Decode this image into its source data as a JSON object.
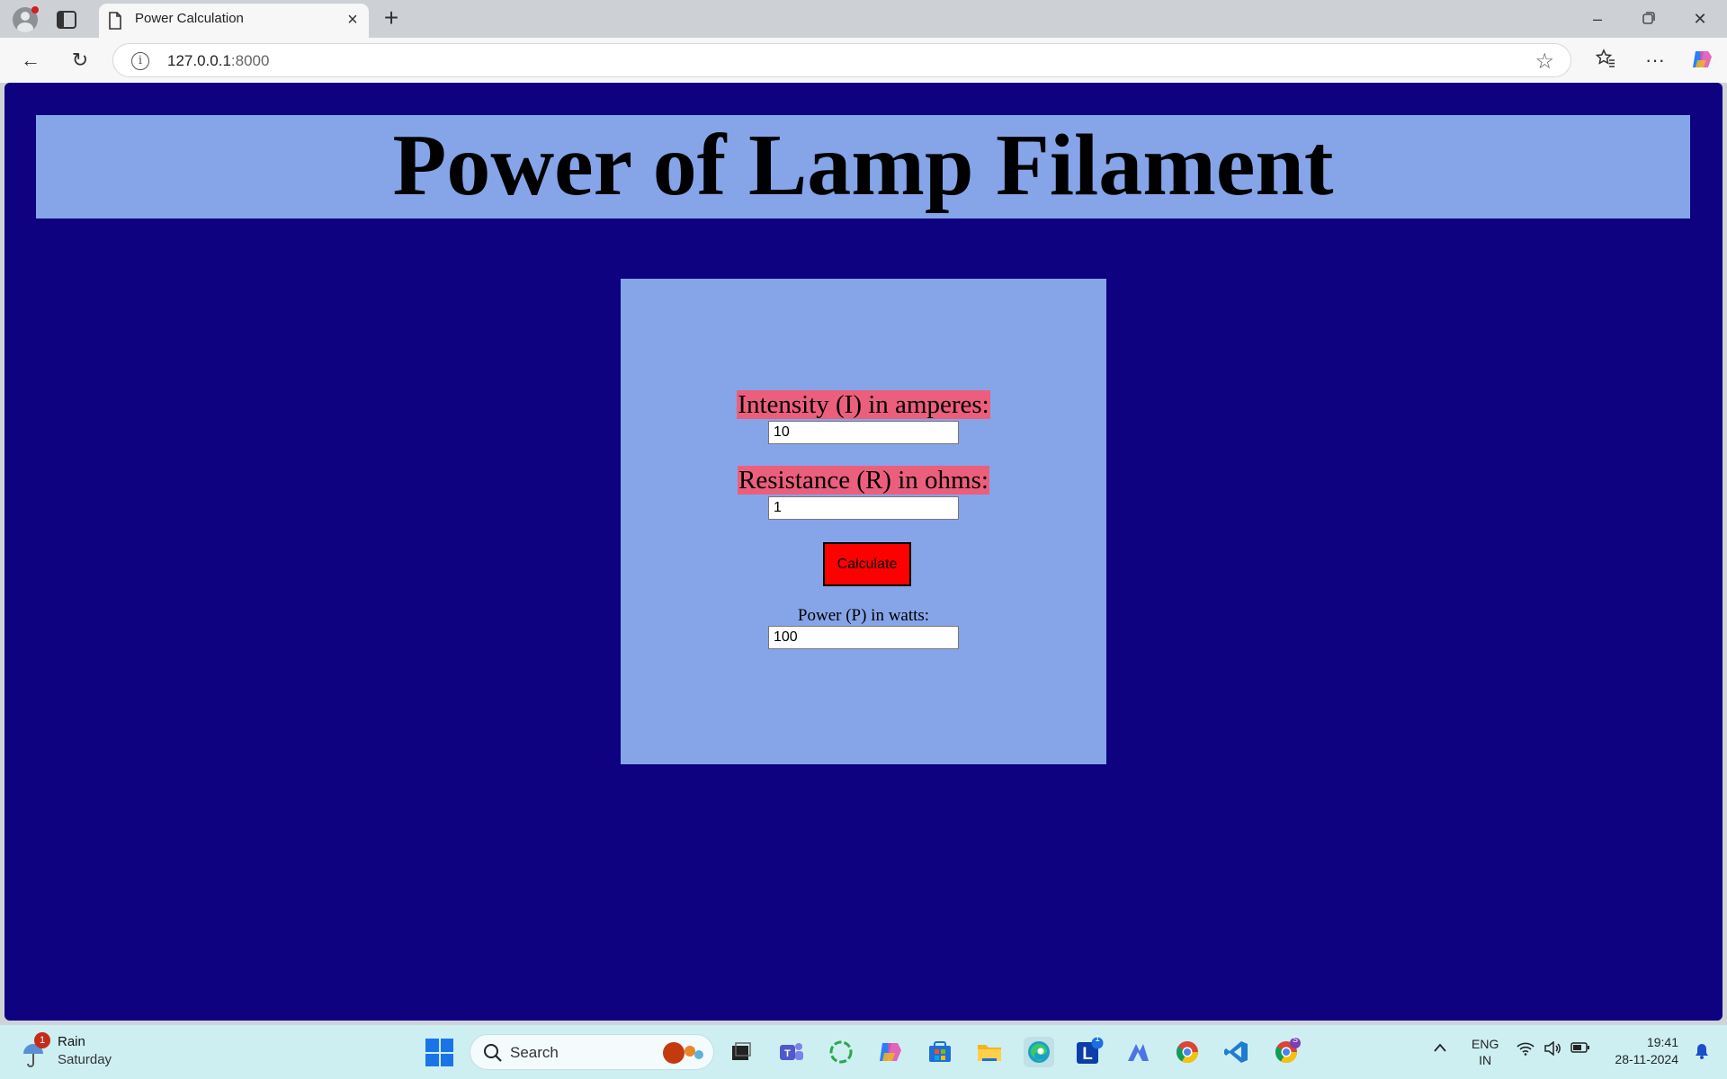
{
  "browser": {
    "tab_title": "Power Calculation",
    "url_host": "127.0.0.1",
    "url_port": ":8000"
  },
  "page": {
    "heading": "Power of Lamp Filament",
    "intensity_label": "Intensity (I) in amperes:",
    "intensity_value": "10",
    "resistance_label": "Resistance (R) in ohms:",
    "resistance_value": "1",
    "calculate_label": "Calculate",
    "power_label": "Power (P) in watts:",
    "power_value": "100"
  },
  "colors": {
    "page_background": "#0f0280",
    "panel_background": "#86a5e9",
    "label_highlight": "#eb5f7d",
    "button_background": "#ff0000"
  },
  "taskbar": {
    "weather_badge": "1",
    "weather_condition": "Rain",
    "weather_day": "Saturday",
    "search_label": "Search",
    "app_badge": "1",
    "chrome_badge": "S",
    "lang_primary": "ENG",
    "lang_secondary": "IN",
    "time": "19:41",
    "date": "28-11-2024"
  },
  "icons": [
    "profile-icon",
    "tab-actions-icon",
    "page-icon",
    "close-icon",
    "new-tab-icon",
    "minimize-icon",
    "restore-icon",
    "window-close-icon",
    "back-icon",
    "refresh-icon",
    "info-icon",
    "favorite-star-icon",
    "favorites-icon",
    "more-icon",
    "copilot-icon",
    "weather-icon",
    "windows-start-icon",
    "search-icon",
    "chevron-up-icon",
    "wifi-icon",
    "volume-icon",
    "battery-icon",
    "notification-bell-icon"
  ]
}
